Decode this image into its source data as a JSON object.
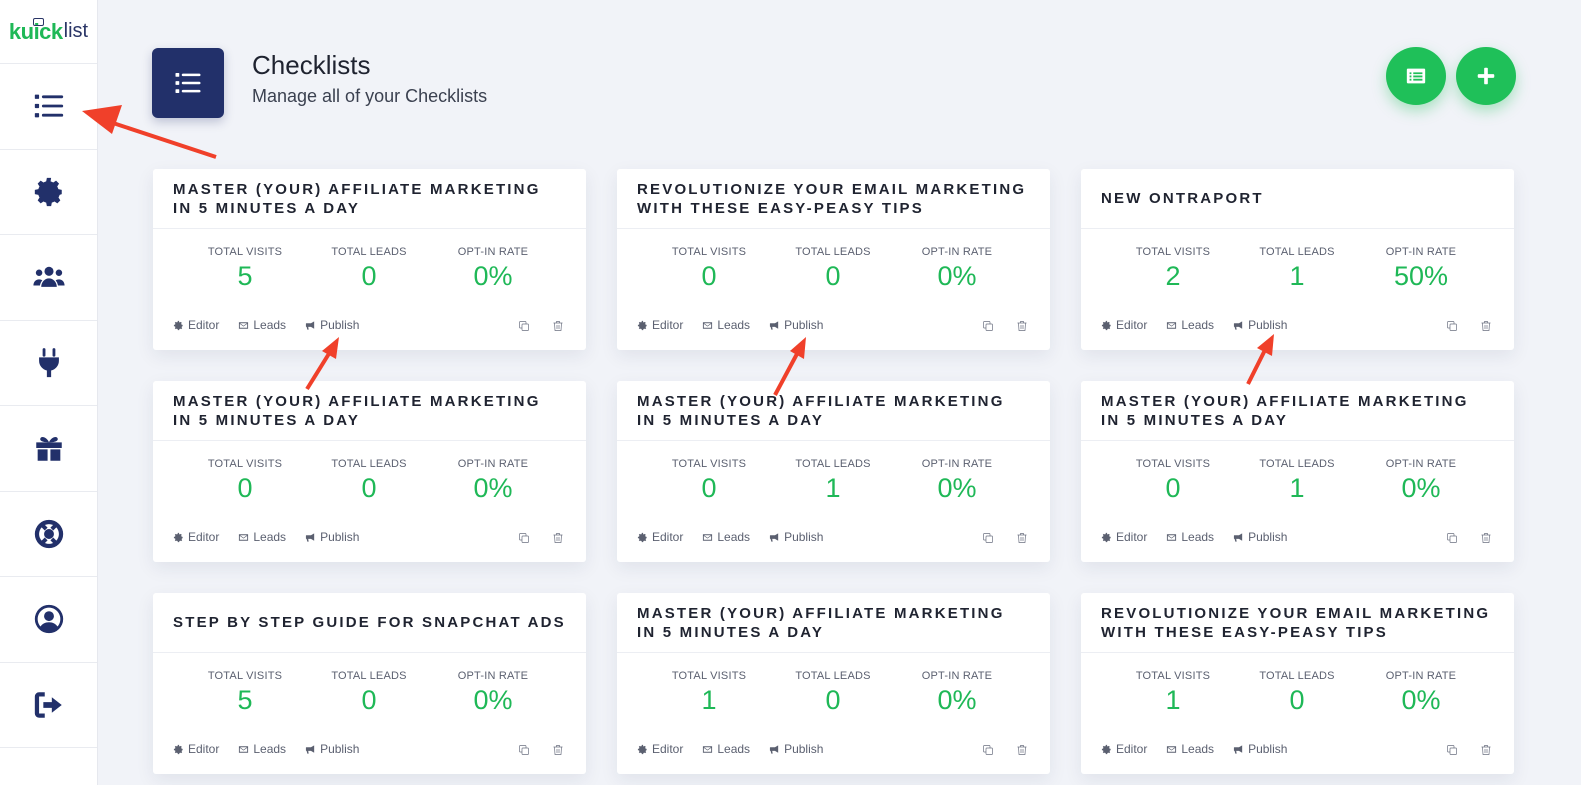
{
  "logo": {
    "brand_part1": "kuick",
    "brand_part2": "list"
  },
  "sidebar": {
    "items": [
      {
        "name": "checklists",
        "icon": "list-icon"
      },
      {
        "name": "settings",
        "icon": "gear-icon"
      },
      {
        "name": "users",
        "icon": "users-icon"
      },
      {
        "name": "integrations",
        "icon": "plug-icon"
      },
      {
        "name": "rewards",
        "icon": "gift-icon"
      },
      {
        "name": "support",
        "icon": "lifebuoy-icon"
      },
      {
        "name": "account",
        "icon": "user-circle-icon"
      },
      {
        "name": "logout",
        "icon": "sign-out-icon"
      }
    ]
  },
  "header": {
    "title": "Checklists",
    "subtitle": "Manage all of your Checklists"
  },
  "labels": {
    "total_visits": "TOTAL VISITS",
    "total_leads": "TOTAL LEADS",
    "optin_rate": "OPT-IN RATE",
    "editor": "Editor",
    "leads": "Leads",
    "publish": "Publish"
  },
  "cards": [
    {
      "title": "MASTER (YOUR) AFFILIATE MARKETING IN 5 MINUTES A DAY",
      "visits": "5",
      "leads": "0",
      "rate": "0%"
    },
    {
      "title": "REVOLUTIONIZE YOUR EMAIL MARKETING WITH THESE EASY-PEASY TIPS",
      "visits": "0",
      "leads": "0",
      "rate": "0%"
    },
    {
      "title": "NEW ONTRAPORT",
      "visits": "2",
      "leads": "1",
      "rate": "50%"
    },
    {
      "title": "MASTER (YOUR) AFFILIATE MARKETING IN 5 MINUTES A DAY",
      "visits": "0",
      "leads": "0",
      "rate": "0%"
    },
    {
      "title": "MASTER (YOUR) AFFILIATE MARKETING IN 5 MINUTES A DAY",
      "visits": "0",
      "leads": "1",
      "rate": "0%"
    },
    {
      "title": "MASTER (YOUR) AFFILIATE MARKETING IN 5 MINUTES A DAY",
      "visits": "0",
      "leads": "1",
      "rate": "0%"
    },
    {
      "title": "STEP BY STEP GUIDE FOR SNAPCHAT ADS",
      "visits": "5",
      "leads": "0",
      "rate": "0%"
    },
    {
      "title": "MASTER (YOUR) AFFILIATE MARKETING IN 5 MINUTES A DAY",
      "visits": "1",
      "leads": "0",
      "rate": "0%"
    },
    {
      "title": "REVOLUTIONIZE YOUR EMAIL MARKETING WITH THESE EASY-PEASY TIPS",
      "visits": "1",
      "leads": "0",
      "rate": "0%"
    }
  ],
  "colors": {
    "accent_green": "#1fb857",
    "navy": "#22306a",
    "annotation_red": "#f0402a"
  }
}
